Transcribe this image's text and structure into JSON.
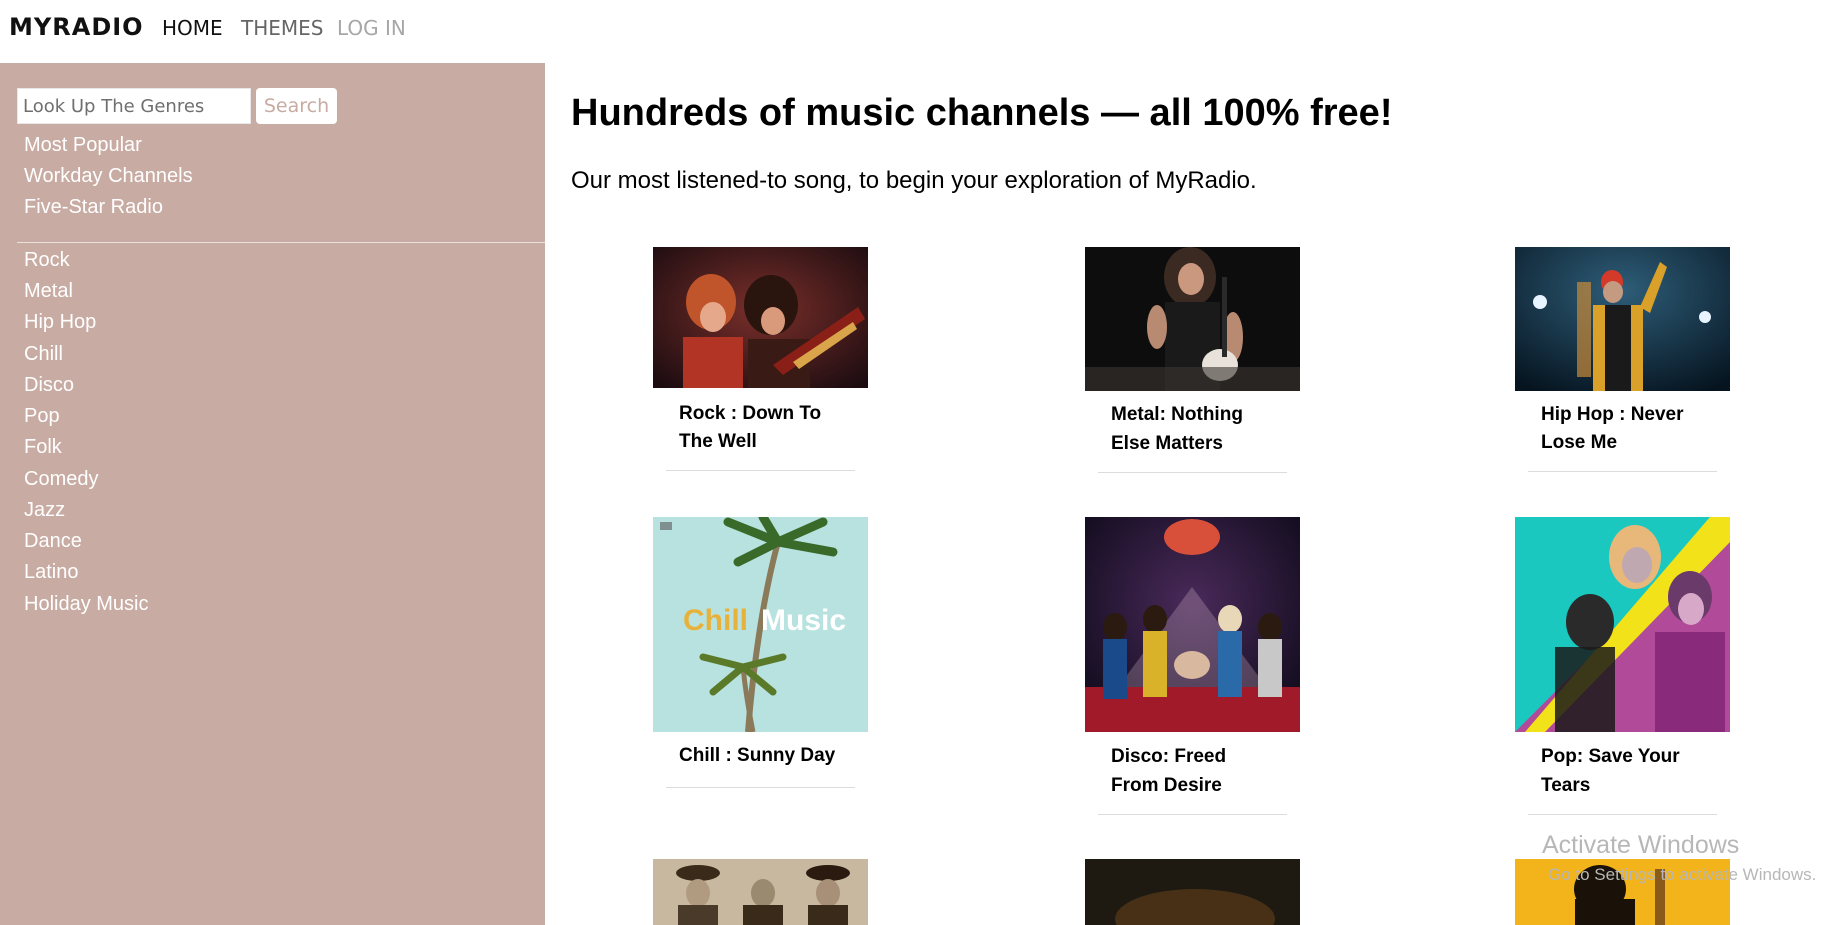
{
  "nav": {
    "brand": "MYRADIO",
    "home": "HOME",
    "themes": "THEMES",
    "login": "LOG IN"
  },
  "sidebar": {
    "search_placeholder": "Look Up The Genres",
    "search_button": "Search",
    "featured": [
      "Most Popular",
      "Workday Channels",
      "Five-Star Radio"
    ],
    "genres": [
      "Rock",
      "Metal",
      "Hip Hop",
      "Chill",
      "Disco",
      "Pop",
      "Folk",
      "Comedy",
      "Jazz",
      "Dance",
      "Latino",
      "Holiday Music"
    ]
  },
  "main": {
    "title": "Hundreds of music channels — all 100% free!",
    "subtitle": "Our most listened-to song, to begin your exploration of MyRadio.",
    "cards": [
      {
        "line1": "Rock : Down To",
        "line2": "The Well"
      },
      {
        "line1": "Metal: Nothing",
        "line2": "Else Matters"
      },
      {
        "line1": "Hip Hop : Never",
        "line2": "Lose Me"
      },
      {
        "line1": "Chill : Sunny Day",
        "line2": ""
      },
      {
        "line1": "Disco: Freed",
        "line2": "From Desire"
      },
      {
        "line1": "Pop: Save Your",
        "line2": "Tears"
      }
    ],
    "chill_art_text_1": "Chill",
    "chill_art_text_2": "Music"
  },
  "watermark": {
    "line1": "Activate Windows",
    "line2": "Go to Settings to activate Windows."
  },
  "colors": {
    "sidebar_bg": "#c8aba2",
    "sidebar_text": "#ffffff",
    "search_button_text": "#c8aba2"
  }
}
